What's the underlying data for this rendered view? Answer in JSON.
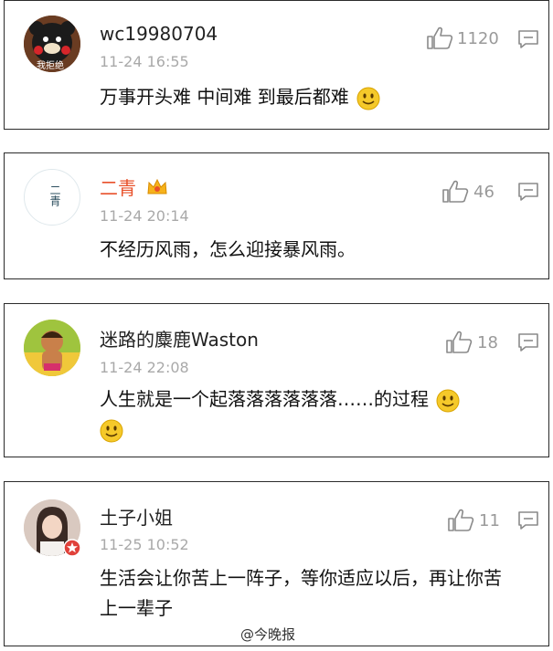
{
  "comments": [
    {
      "username": "wc19980704",
      "avatar_text": "我拒绝",
      "time": "11-24 16:55",
      "likes": "1120",
      "text": "万事开头难 中间难 到最后都难",
      "username_color": "#222222",
      "emoji": "smile-emoji"
    },
    {
      "username": "二青",
      "avatar_text": "二青",
      "time": "11-24 20:14",
      "likes": "46",
      "text": "不经历风雨，怎么迎接暴风雨。",
      "username_color": "#e8512a",
      "badge": "crown-icon"
    },
    {
      "username": "迷路的麋鹿Waston",
      "time": "11-24 22:08",
      "likes": "18",
      "text": "人生就是一个起落落落落落落……的过程",
      "username_color": "#222222",
      "emoji": "smile-emoji"
    },
    {
      "username": "土子小姐",
      "time": "11-25 10:52",
      "likes": "11",
      "text": "生活会让你苦上一阵子，等你适应以后，再让你苦上一辈子",
      "username_color": "#222222",
      "badge": "verified-badge"
    }
  ],
  "watermark": "@今晚报"
}
